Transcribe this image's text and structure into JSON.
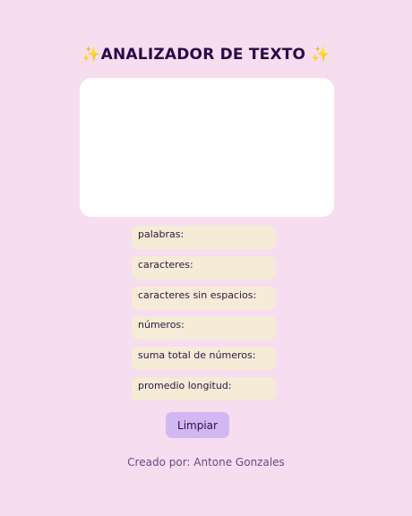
{
  "header": {
    "title": "✨ANALIZADOR DE TEXTO ✨"
  },
  "input": {
    "value": "",
    "placeholder": ""
  },
  "stats": [
    {
      "label": "palabras:"
    },
    {
      "label": "caracteres:"
    },
    {
      "label": "caracteres sin espacios:"
    },
    {
      "label": "números:"
    },
    {
      "label": "suma total de números:"
    },
    {
      "label": "promedio longitud:"
    }
  ],
  "actions": {
    "clear_label": "Limpiar"
  },
  "footer": {
    "credit": "Creado por: Antone Gonzales"
  },
  "colors": {
    "background": "#f6ddef",
    "title": "#2a0a4a",
    "stat_background": "#f5ebd6",
    "button_background": "#d2b8f2",
    "textarea_background": "#ffffff"
  }
}
